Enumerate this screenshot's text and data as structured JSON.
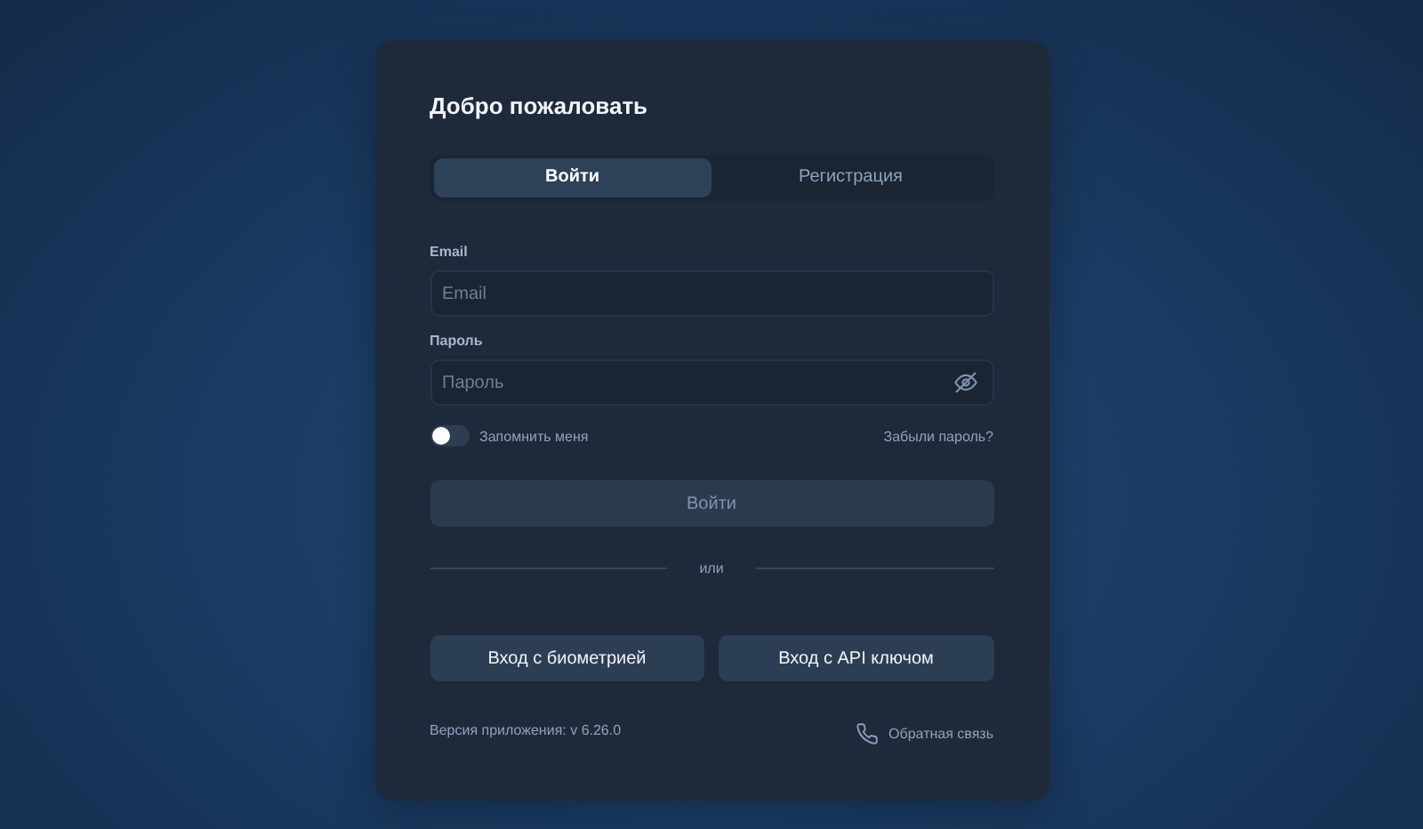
{
  "title": "Добро пожаловать",
  "tabs": [
    {
      "label": "Войти",
      "selected": true
    },
    {
      "label": "Регистрация",
      "selected": false
    }
  ],
  "fields": [
    {
      "label": "Email",
      "placeholder": "Email",
      "kind": "text"
    },
    {
      "label": "Пароль",
      "placeholder": "Пароль",
      "kind": "password"
    }
  ],
  "remember": {
    "label": "Запомнить меня",
    "on": false
  },
  "forgot_link": "Забыли пароль?",
  "submit": {
    "label": "Войти",
    "disabled": true
  },
  "divider_text": "или",
  "alt_buttons": [
    "Вход с биометрией",
    "Вход с API ключом"
  ],
  "version": "Версия приложения: v 6.26.0",
  "feedback_link": "Обратная связь"
}
